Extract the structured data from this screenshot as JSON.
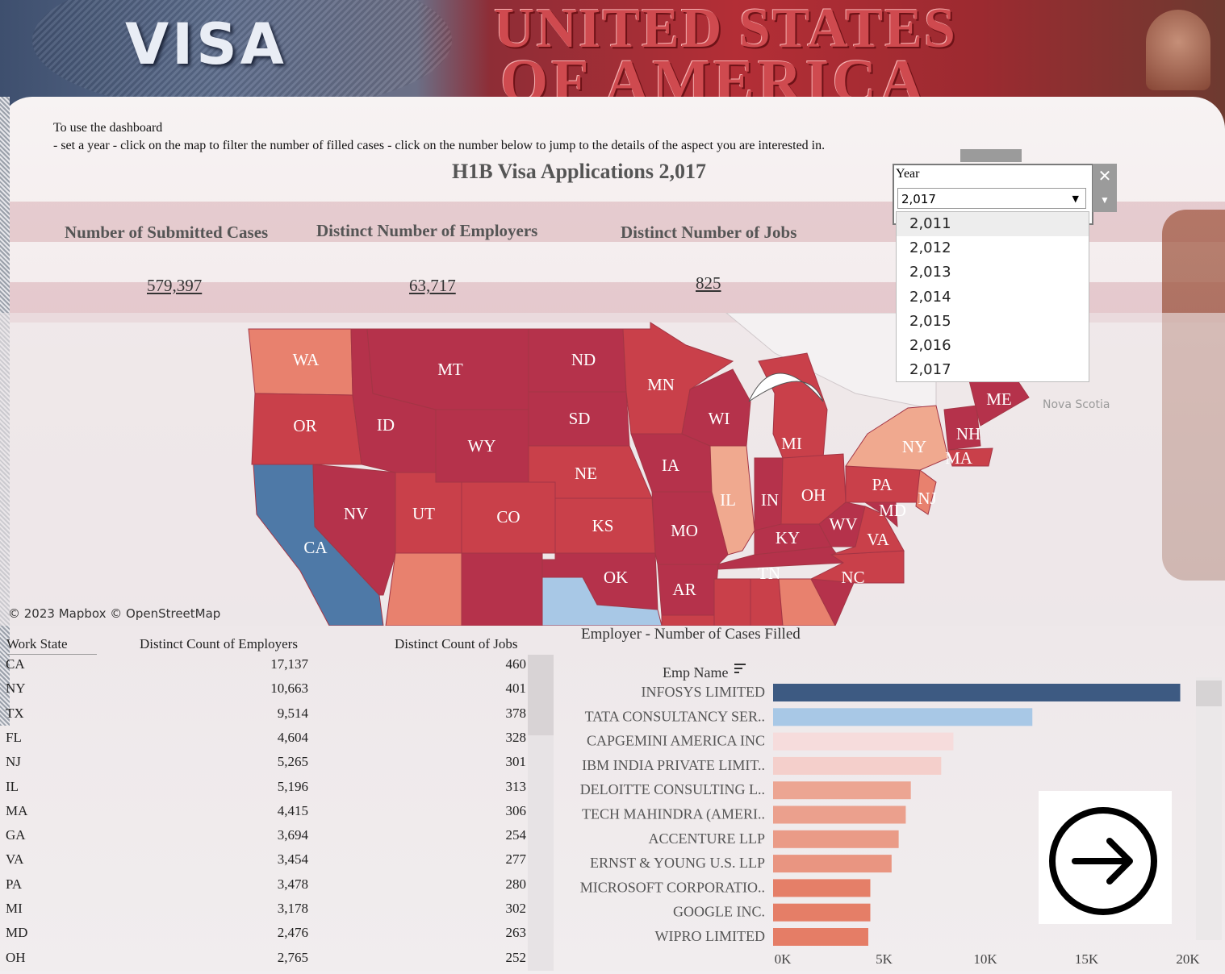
{
  "banner": {
    "visa_text": "VISA",
    "line1": "UNITED STATES",
    "line2": "OF AMERICA"
  },
  "instructions": {
    "line1": "To use the dashboard",
    "line2": "- set a year - click on the map to filter the number of filled cases - click on the number below to jump to the details of the aspect you are interested in."
  },
  "title": "H1B Visa Applications 2,017",
  "kpis": [
    {
      "label": "Number  of Submitted Cases",
      "value": "579,397"
    },
    {
      "label": "Distinct Number of Employers",
      "value": "63,717"
    },
    {
      "label": "Distinct Number of Jobs",
      "value": "825"
    }
  ],
  "year_filter": {
    "label": "Year",
    "selected": "2,017",
    "options": [
      "2,011",
      "2,012",
      "2,013",
      "2,014",
      "2,015",
      "2,016",
      "2,017"
    ],
    "close_icon": "close-icon",
    "menu_icon": "chevron-down-icon"
  },
  "map": {
    "credit": "© 2023 Mapbox  © OpenStreetMap",
    "outside_label": "Nova Scotia",
    "state_labels": [
      "WA",
      "OR",
      "CA",
      "ID",
      "NV",
      "MT",
      "WY",
      "UT",
      "CO",
      "ND",
      "SD",
      "NE",
      "KS",
      "OK",
      "MN",
      "IA",
      "MO",
      "AR",
      "WI",
      "IL",
      "MI",
      "IN",
      "OH",
      "KY",
      "TN",
      "WV",
      "VA",
      "NC",
      "PA",
      "NY",
      "MD",
      "NJ",
      "ME",
      "NH",
      "MA"
    ],
    "colors": {
      "high": "#4e79a7",
      "light_blue": "#a8c8e6",
      "dark_red": "#b5324b",
      "red": "#c9404a",
      "salmon": "#e8816e",
      "light_salmon": "#f0a98f"
    }
  },
  "state_table": {
    "headers": [
      "Work State",
      "Distinct Count of Employers",
      "Distinct Count of Jobs"
    ],
    "rows": [
      [
        "CA",
        "17,137",
        "460"
      ],
      [
        "NY",
        "10,663",
        "401"
      ],
      [
        "TX",
        "9,514",
        "378"
      ],
      [
        "FL",
        "4,604",
        "328"
      ],
      [
        "NJ",
        "5,265",
        "301"
      ],
      [
        "IL",
        "5,196",
        "313"
      ],
      [
        "MA",
        "4,415",
        "306"
      ],
      [
        "GA",
        "3,694",
        "254"
      ],
      [
        "VA",
        "3,454",
        "277"
      ],
      [
        "PA",
        "3,478",
        "280"
      ],
      [
        "MI",
        "3,178",
        "302"
      ],
      [
        "MD",
        "2,476",
        "263"
      ],
      [
        "OH",
        "2,765",
        "252"
      ]
    ]
  },
  "chart_data": {
    "type": "bar",
    "title": "Employer - Number of Cases Filled",
    "ylabel": "Emp Name",
    "orientation": "horizontal",
    "categories": [
      "INFOSYS LIMITED",
      "TATA CONSULTANCY SER..",
      "CAPGEMINI AMERICA INC",
      "IBM INDIA PRIVATE LIMIT..",
      "DELOITTE CONSULTING L..",
      "TECH MAHINDRA (AMERI..",
      "ACCENTURE LLP",
      "ERNST & YOUNG U.S. LLP",
      "MICROSOFT CORPORATIO..",
      "GOOGLE INC.",
      "WIPRO LIMITED"
    ],
    "values": [
      20100,
      12800,
      8900,
      8300,
      6800,
      6550,
      6200,
      5850,
      4800,
      4800,
      4700
    ],
    "colors": [
      "#3d5a82",
      "#a8c8e6",
      "#f6dcdc",
      "#f4cfcb",
      "#eca592",
      "#eba08d",
      "#ea9b87",
      "#e99581",
      "#e57f68",
      "#e57e67",
      "#e57d66"
    ],
    "ticks": [
      "0K",
      "5K",
      "10K",
      "15K",
      "20K"
    ],
    "xlim": [
      0,
      20000
    ],
    "sort_icon": "sort-descending-icon"
  },
  "next_button": {
    "icon": "arrow-right-circle-icon"
  }
}
